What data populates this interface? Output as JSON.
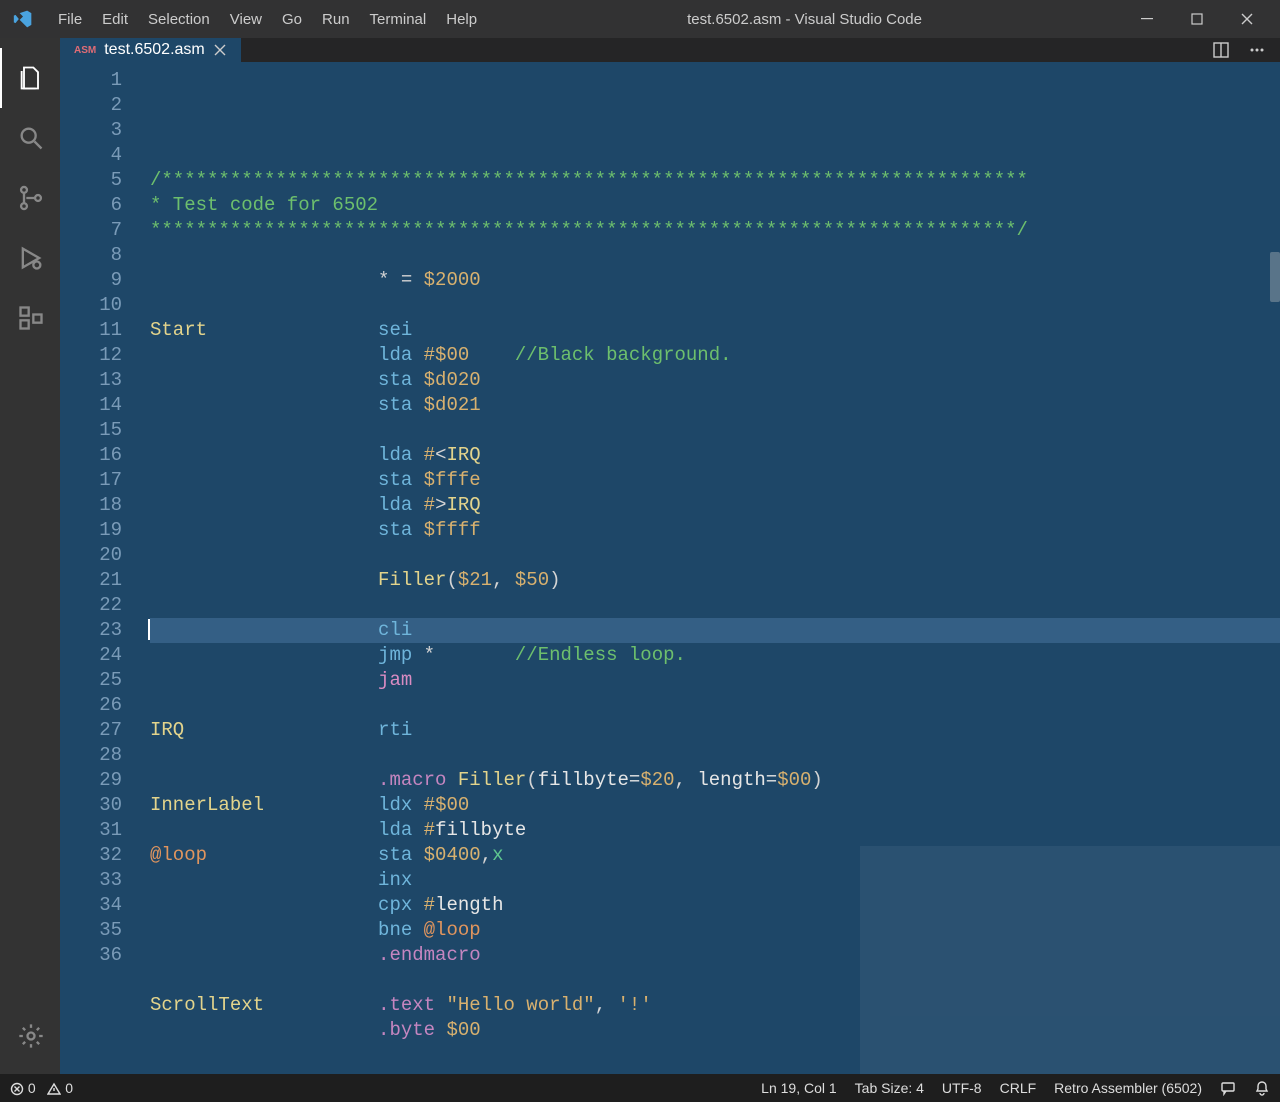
{
  "titlebar": {
    "menu": [
      "File",
      "Edit",
      "Selection",
      "View",
      "Go",
      "Run",
      "Terminal",
      "Help"
    ],
    "title": "test.6502.asm - Visual Studio Code"
  },
  "tabs": {
    "items": [
      {
        "label": "test.6502.asm",
        "badge": "ASM"
      }
    ]
  },
  "editor": {
    "current_line": 19,
    "lines": [
      {
        "n": 1,
        "tokens": [
          [
            "blockcomment",
            "/****************************************************************************"
          ]
        ]
      },
      {
        "n": 2,
        "tokens": [
          [
            "blockcomment",
            "* Test code for 6502"
          ]
        ]
      },
      {
        "n": 3,
        "tokens": [
          [
            "blockcomment",
            "****************************************************************************/"
          ]
        ]
      },
      {
        "n": 4,
        "tokens": []
      },
      {
        "n": 5,
        "tokens": [
          [
            "plain",
            "                    "
          ],
          [
            "punct",
            "* = "
          ],
          [
            "num",
            "$2000"
          ]
        ]
      },
      {
        "n": 6,
        "tokens": []
      },
      {
        "n": 7,
        "tokens": [
          [
            "label",
            "Start"
          ],
          [
            "plain",
            "               "
          ],
          [
            "mnemonic",
            "sei"
          ]
        ]
      },
      {
        "n": 8,
        "tokens": [
          [
            "plain",
            "                    "
          ],
          [
            "mnemonic",
            "lda "
          ],
          [
            "num",
            "#$00"
          ],
          [
            "plain",
            "    "
          ],
          [
            "comment",
            "//Black background."
          ]
        ]
      },
      {
        "n": 9,
        "tokens": [
          [
            "plain",
            "                    "
          ],
          [
            "mnemonic",
            "sta "
          ],
          [
            "num",
            "$d020"
          ]
        ]
      },
      {
        "n": 10,
        "tokens": [
          [
            "plain",
            "                    "
          ],
          [
            "mnemonic",
            "sta "
          ],
          [
            "num",
            "$d021"
          ]
        ]
      },
      {
        "n": 11,
        "tokens": []
      },
      {
        "n": 12,
        "tokens": [
          [
            "plain",
            "                    "
          ],
          [
            "mnemonic",
            "lda "
          ],
          [
            "num",
            "#"
          ],
          [
            "punct",
            "<"
          ],
          [
            "label",
            "IRQ"
          ]
        ]
      },
      {
        "n": 13,
        "tokens": [
          [
            "plain",
            "                    "
          ],
          [
            "mnemonic",
            "sta "
          ],
          [
            "num",
            "$fffe"
          ]
        ]
      },
      {
        "n": 14,
        "tokens": [
          [
            "plain",
            "                    "
          ],
          [
            "mnemonic",
            "lda "
          ],
          [
            "num",
            "#"
          ],
          [
            "punct",
            ">"
          ],
          [
            "label",
            "IRQ"
          ]
        ]
      },
      {
        "n": 15,
        "tokens": [
          [
            "plain",
            "                    "
          ],
          [
            "mnemonic",
            "sta "
          ],
          [
            "num",
            "$ffff"
          ]
        ]
      },
      {
        "n": 16,
        "tokens": []
      },
      {
        "n": 17,
        "tokens": [
          [
            "plain",
            "                    "
          ],
          [
            "label",
            "Filler"
          ],
          [
            "punct",
            "("
          ],
          [
            "num",
            "$21"
          ],
          [
            "punct",
            ", "
          ],
          [
            "num",
            "$50"
          ],
          [
            "punct",
            ")"
          ]
        ]
      },
      {
        "n": 18,
        "tokens": []
      },
      {
        "n": 19,
        "tokens": [
          [
            "plain",
            "                    "
          ],
          [
            "mnemonic",
            "cli"
          ]
        ]
      },
      {
        "n": 20,
        "tokens": [
          [
            "plain",
            "                    "
          ],
          [
            "mnemonic",
            "jmp "
          ],
          [
            "punct",
            "*"
          ],
          [
            "plain",
            "       "
          ],
          [
            "comment",
            "//Endless loop."
          ]
        ]
      },
      {
        "n": 21,
        "tokens": [
          [
            "plain",
            "                    "
          ],
          [
            "pink",
            "jam"
          ]
        ]
      },
      {
        "n": 22,
        "tokens": []
      },
      {
        "n": 23,
        "tokens": [
          [
            "label",
            "IRQ"
          ],
          [
            "plain",
            "                 "
          ],
          [
            "mnemonic",
            "rti"
          ]
        ]
      },
      {
        "n": 24,
        "tokens": []
      },
      {
        "n": 25,
        "tokens": [
          [
            "plain",
            "                    "
          ],
          [
            "dir",
            ".macro"
          ],
          [
            "plain",
            " "
          ],
          [
            "label",
            "Filler"
          ],
          [
            "punct",
            "("
          ],
          [
            "plain",
            "fillbyte="
          ],
          [
            "num",
            "$20"
          ],
          [
            "punct",
            ", "
          ],
          [
            "plain",
            "length="
          ],
          [
            "num",
            "$00"
          ],
          [
            "punct",
            ")"
          ]
        ]
      },
      {
        "n": 26,
        "tokens": [
          [
            "label",
            "InnerLabel"
          ],
          [
            "plain",
            "          "
          ],
          [
            "mnemonic",
            "ldx "
          ],
          [
            "num",
            "#$00"
          ]
        ]
      },
      {
        "n": 27,
        "tokens": [
          [
            "plain",
            "                    "
          ],
          [
            "mnemonic",
            "lda "
          ],
          [
            "num",
            "#"
          ],
          [
            "plain",
            "fillbyte"
          ]
        ]
      },
      {
        "n": 28,
        "tokens": [
          [
            "label2",
            "@loop"
          ],
          [
            "plain",
            "               "
          ],
          [
            "mnemonic",
            "sta "
          ],
          [
            "num",
            "$0400"
          ],
          [
            "punct",
            ","
          ],
          [
            "reg",
            "x"
          ]
        ]
      },
      {
        "n": 29,
        "tokens": [
          [
            "plain",
            "                    "
          ],
          [
            "mnemonic",
            "inx"
          ]
        ]
      },
      {
        "n": 30,
        "tokens": [
          [
            "plain",
            "                    "
          ],
          [
            "mnemonic",
            "cpx "
          ],
          [
            "num",
            "#"
          ],
          [
            "plain",
            "length"
          ]
        ]
      },
      {
        "n": 31,
        "tokens": [
          [
            "plain",
            "                    "
          ],
          [
            "mnemonic",
            "bne "
          ],
          [
            "label2",
            "@loop"
          ]
        ]
      },
      {
        "n": 32,
        "tokens": [
          [
            "plain",
            "                    "
          ],
          [
            "dir",
            ".endmacro"
          ]
        ]
      },
      {
        "n": 33,
        "tokens": []
      },
      {
        "n": 34,
        "tokens": [
          [
            "label",
            "ScrollText"
          ],
          [
            "plain",
            "          "
          ],
          [
            "dir",
            ".text"
          ],
          [
            "plain",
            " "
          ],
          [
            "string",
            "\"Hello world\""
          ],
          [
            "punct",
            ", "
          ],
          [
            "string",
            "'!'"
          ]
        ]
      },
      {
        "n": 35,
        "tokens": [
          [
            "plain",
            "                    "
          ],
          [
            "dir",
            ".byte"
          ],
          [
            "plain",
            " "
          ],
          [
            "num",
            "$00"
          ]
        ]
      },
      {
        "n": 36,
        "tokens": []
      }
    ]
  },
  "statusbar": {
    "errors": "0",
    "warnings": "0",
    "position": "Ln 19, Col 1",
    "tabsize": "Tab Size: 4",
    "encoding": "UTF-8",
    "eol": "CRLF",
    "language": "Retro Assembler (6502)"
  }
}
